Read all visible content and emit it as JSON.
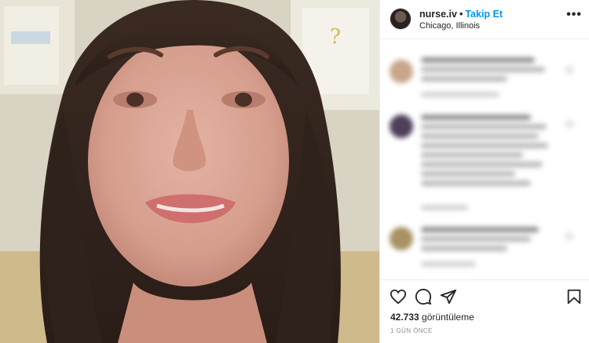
{
  "post": {
    "username": "nurse.iv",
    "separator": "•",
    "follow_label": "Takip Et",
    "location": "Chicago, Illinois",
    "more_label": "•••"
  },
  "media": {
    "type": "video"
  },
  "comments_section": {
    "blurred": true,
    "items": [
      {
        "avatar_color": "#c9a689"
      },
      {
        "avatar_color": "#4e3f5a"
      },
      {
        "avatar_color": "#a89263"
      }
    ]
  },
  "engagement": {
    "view_count": "42.733",
    "view_label": "görüntüleme",
    "timestamp": "1 GÜN ÖNCE"
  },
  "icons": {
    "like": "heart-icon",
    "comment": "comment-bubble-icon",
    "share": "paper-plane-icon",
    "save": "bookmark-icon"
  }
}
